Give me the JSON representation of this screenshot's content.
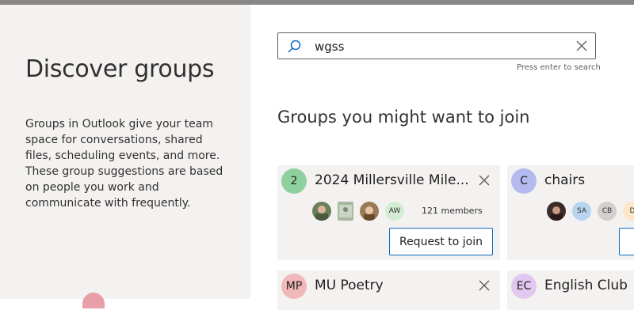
{
  "left_panel": {
    "title": "Discover groups",
    "description": "Groups in Outlook give your team space for conversations, shared files, scheduling events, and more. These group suggestions are based on people you work and communicate with frequently."
  },
  "search": {
    "value": "wgss",
    "hint": "Press enter to search",
    "icons": [
      "search-icon",
      "close-icon"
    ]
  },
  "section_title": "Groups you might want to join",
  "groups": [
    {
      "initial": "2",
      "icon_color": "#8fd19e",
      "name": "2024 Millersville Mile...",
      "avatars": [
        {
          "type": "photo",
          "color": "#6b7f5c"
        },
        {
          "type": "photo",
          "color": "#a8b8a0"
        },
        {
          "type": "photo",
          "color": "#9a7a56"
        },
        {
          "type": "initials",
          "label": "AW",
          "color": "#d5ecd4"
        }
      ],
      "members": "121 members",
      "action": "Request to join"
    },
    {
      "initial": "C",
      "icon_color": "#b4baf0",
      "name": "chairs",
      "avatars": [
        {
          "type": "photo",
          "color": "#3b2a2a"
        },
        {
          "type": "initials",
          "label": "SA",
          "color": "#b8d4f0"
        },
        {
          "type": "initials",
          "label": "CB",
          "color": "#d2d0ce"
        },
        {
          "type": "initials",
          "label": "D",
          "color": "#fde7c8"
        }
      ]
    },
    {
      "initial": "MP",
      "icon_color": "#f0b8b8",
      "name": "MU Poetry"
    },
    {
      "initial": "EC",
      "icon_color": "#e2c8f0",
      "name": "English Club"
    }
  ]
}
